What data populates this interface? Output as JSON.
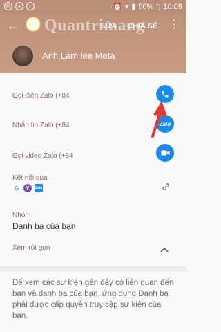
{
  "status_bar": {
    "battery": "50%",
    "time": "16:09"
  },
  "header": {
    "watermark": "Quantrimang",
    "edit_label": "SỬA",
    "share_label": "CHIA SẺ",
    "contact_name": "Anh Lam lee Meta"
  },
  "rows": {
    "call_label": "Gọi điện Zalo (+84",
    "message_label": "Nhắn tin Zalo (+84",
    "video_label": "Gọi video Zalo (+84",
    "connect_label": "Kết nối qua",
    "message_icon_text": "Zalo"
  },
  "sources": {
    "google": "G",
    "viber": "V",
    "zalo": "Zalo"
  },
  "group": {
    "label": "Nhóm",
    "value": "Danh bạ của bạn"
  },
  "collapse_label": "Xem rút gọn",
  "permission_text": "Để xem các sự kiện gần đây có liên quan đến bạn và danh bạ của bạn, ứng dụng Danh bạ phải được cấp quyền truy cập sự kiện của bạn.",
  "colors": {
    "header": "#bd9279",
    "accent": "#1e88e5",
    "annotation_arrow": "#e53935"
  }
}
